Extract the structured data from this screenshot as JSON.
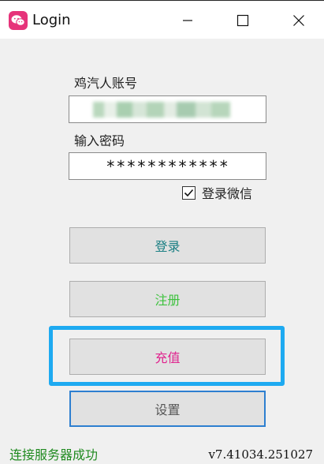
{
  "window": {
    "title": "Login",
    "icon": "wechat-icon",
    "controls": [
      "minimize-icon",
      "maximize-icon",
      "close-icon"
    ]
  },
  "form": {
    "account_label": "鸡汽人账号",
    "account_value": "",
    "password_label": "输入密码",
    "password_value": "************",
    "checkbox_label": "登录微信",
    "checkbox_checked": true
  },
  "buttons": {
    "login": "登录",
    "register": "注册",
    "recharge": "充值",
    "settings": "设置"
  },
  "colors": {
    "login_text": "#1a7f83",
    "register_text": "#3ec23e",
    "recharge_text": "#e0248e",
    "highlight": "#1eaaf1",
    "status_text": "#1f8a1f"
  },
  "footer": {
    "status": "连接服务器成功",
    "version": "v7.41034.251027"
  }
}
